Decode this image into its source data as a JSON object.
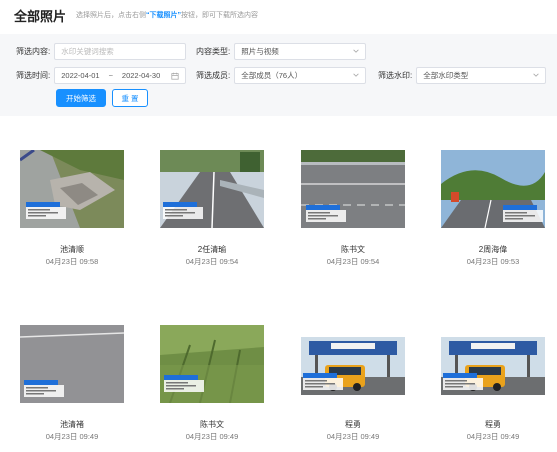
{
  "header": {
    "title": "全部照片",
    "hint_prefix": "选择照片后，点击右侧",
    "hint_link": "“下载照片”",
    "hint_suffix": "按钮，即可下载所选内容"
  },
  "filters": {
    "content_label": "筛选内容:",
    "content_placeholder": "水印关键词搜索",
    "type_label": "内容类型:",
    "type_value": "照片与视频",
    "time_label": "筛选时间:",
    "date_start": "2022-04-01",
    "date_sep": "~",
    "date_end": "2022-04-30",
    "member_label": "筛选成员:",
    "member_value": "全部成员（76人）",
    "watermark_label": "筛选水印:",
    "watermark_value": "全部水印类型",
    "search_button": "开始筛选",
    "reset_button": "重 置"
  },
  "photos": [
    {
      "name": "池清顺",
      "time": "04月23日 09:58",
      "scene": "road-crack"
    },
    {
      "name": "2任清瑜",
      "time": "04月23日 09:54",
      "scene": "highway-guardrail"
    },
    {
      "name": "陈书文",
      "time": "04月23日 09:54",
      "scene": "highway-lanes"
    },
    {
      "name": "2周海偉",
      "time": "04月23日 09:53",
      "scene": "highway-hills"
    },
    {
      "name": "池清褚",
      "time": "04月23日 09:49",
      "scene": "asphalt"
    },
    {
      "name": "陈书文",
      "time": "04月23日 09:49",
      "scene": "grass-slope"
    },
    {
      "name": "程勇",
      "time": "04月23日 09:49",
      "scene": "toll-gate"
    },
    {
      "name": "程勇",
      "time": "04月23日 09:49",
      "scene": "toll-gate"
    }
  ],
  "colors": {
    "accent": "#1890ff",
    "filter_bg": "#f6f7f9",
    "watermark_blue": "#1e6fd9"
  }
}
